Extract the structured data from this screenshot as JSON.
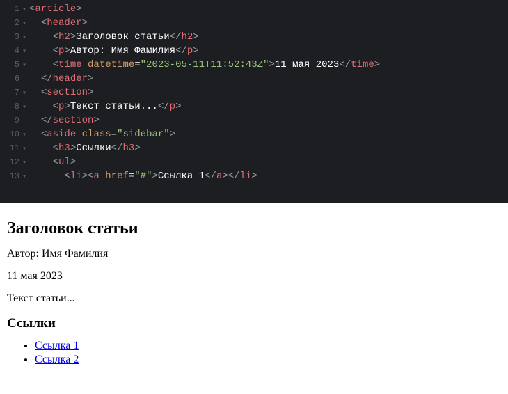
{
  "editor": {
    "lines": [
      {
        "n": "1",
        "fold": "▾",
        "tokens": [
          [
            "punc",
            "<"
          ],
          [
            "tag",
            "article"
          ],
          [
            "punc",
            ">"
          ]
        ]
      },
      {
        "n": "2",
        "fold": "▾",
        "tokens": [
          [
            "text",
            "  "
          ],
          [
            "punc",
            "<"
          ],
          [
            "tag",
            "header"
          ],
          [
            "punc",
            ">"
          ]
        ]
      },
      {
        "n": "3",
        "fold": "▾",
        "tokens": [
          [
            "text",
            "    "
          ],
          [
            "punc",
            "<"
          ],
          [
            "tag",
            "h2"
          ],
          [
            "punc",
            ">"
          ],
          [
            "text",
            "Заголовок статьи"
          ],
          [
            "punc",
            "</"
          ],
          [
            "tag",
            "h2"
          ],
          [
            "punc",
            ">"
          ]
        ]
      },
      {
        "n": "4",
        "fold": "▾",
        "tokens": [
          [
            "text",
            "    "
          ],
          [
            "punc",
            "<"
          ],
          [
            "tag",
            "p"
          ],
          [
            "punc",
            ">"
          ],
          [
            "text",
            "Автор: Имя Фамилия"
          ],
          [
            "punc",
            "</"
          ],
          [
            "tag",
            "p"
          ],
          [
            "punc",
            ">"
          ]
        ]
      },
      {
        "n": "5",
        "fold": "▾",
        "tokens": [
          [
            "text",
            "    "
          ],
          [
            "punc",
            "<"
          ],
          [
            "tag",
            "time"
          ],
          [
            "text",
            " "
          ],
          [
            "attr",
            "datetime"
          ],
          [
            "eq",
            "="
          ],
          [
            "str",
            "\"2023-05-11T11:52:43Z\""
          ],
          [
            "punc",
            ">"
          ],
          [
            "text",
            "11 мая 2023"
          ],
          [
            "punc",
            "</"
          ],
          [
            "tag",
            "time"
          ],
          [
            "punc",
            ">"
          ]
        ]
      },
      {
        "n": "6",
        "fold": " ",
        "tokens": [
          [
            "text",
            "  "
          ],
          [
            "punc",
            "</"
          ],
          [
            "tag",
            "header"
          ],
          [
            "punc",
            ">"
          ]
        ]
      },
      {
        "n": "7",
        "fold": "▾",
        "tokens": [
          [
            "text",
            "  "
          ],
          [
            "punc",
            "<"
          ],
          [
            "tag",
            "section"
          ],
          [
            "punc",
            ">"
          ]
        ]
      },
      {
        "n": "8",
        "fold": "▾",
        "tokens": [
          [
            "text",
            "    "
          ],
          [
            "punc",
            "<"
          ],
          [
            "tag",
            "p"
          ],
          [
            "punc",
            ">"
          ],
          [
            "text",
            "Текст статьи..."
          ],
          [
            "punc",
            "</"
          ],
          [
            "tag",
            "p"
          ],
          [
            "punc",
            ">"
          ]
        ]
      },
      {
        "n": "9",
        "fold": " ",
        "tokens": [
          [
            "text",
            "  "
          ],
          [
            "punc",
            "</"
          ],
          [
            "tag",
            "section"
          ],
          [
            "punc",
            ">"
          ]
        ]
      },
      {
        "n": "10",
        "fold": "▾",
        "tokens": [
          [
            "text",
            "  "
          ],
          [
            "punc",
            "<"
          ],
          [
            "tag",
            "aside"
          ],
          [
            "text",
            " "
          ],
          [
            "attr",
            "class"
          ],
          [
            "eq",
            "="
          ],
          [
            "str",
            "\"sidebar\""
          ],
          [
            "punc",
            ">"
          ]
        ]
      },
      {
        "n": "11",
        "fold": "▾",
        "tokens": [
          [
            "text",
            "    "
          ],
          [
            "punc",
            "<"
          ],
          [
            "tag",
            "h3"
          ],
          [
            "punc",
            ">"
          ],
          [
            "text",
            "Ссылки"
          ],
          [
            "punc",
            "</"
          ],
          [
            "tag",
            "h3"
          ],
          [
            "punc",
            ">"
          ]
        ]
      },
      {
        "n": "12",
        "fold": "▾",
        "tokens": [
          [
            "text",
            "    "
          ],
          [
            "punc",
            "<"
          ],
          [
            "tag",
            "ul"
          ],
          [
            "punc",
            ">"
          ]
        ]
      },
      {
        "n": "13",
        "fold": "▾",
        "tokens": [
          [
            "text",
            "      "
          ],
          [
            "punc",
            "<"
          ],
          [
            "tag",
            "li"
          ],
          [
            "punc",
            ">"
          ],
          [
            "punc",
            "<"
          ],
          [
            "tag",
            "a"
          ],
          [
            "text",
            " "
          ],
          [
            "attr",
            "href"
          ],
          [
            "eq",
            "="
          ],
          [
            "str",
            "\"#\""
          ],
          [
            "punc",
            ">"
          ],
          [
            "text",
            "Ссылка 1"
          ],
          [
            "punc",
            "</"
          ],
          [
            "tag",
            "a"
          ],
          [
            "punc",
            ">"
          ],
          [
            "punc",
            "</"
          ],
          [
            "tag",
            "li"
          ],
          [
            "punc",
            ">"
          ]
        ]
      }
    ]
  },
  "preview": {
    "heading": "Заголовок статьи",
    "author": "Автор: Имя Фамилия",
    "date": "11 мая 2023",
    "body": "Текст статьи...",
    "links_heading": "Ссылки",
    "links": [
      "Ссылка 1",
      "Ссылка 2"
    ]
  }
}
